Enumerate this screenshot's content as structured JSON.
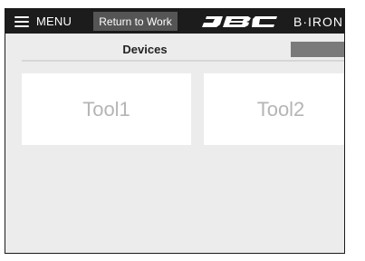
{
  "topbar": {
    "menu_label": "MENU",
    "return_label": "Return to Work",
    "brand_text": "B·IRON",
    "background_color": "#1c1c1c"
  },
  "tabs": {
    "devices_label": "Devices"
  },
  "tools": [
    {
      "label": "Tool1"
    },
    {
      "label": "Tool2"
    }
  ],
  "colors": {
    "screen_background": "#ececec",
    "card_background": "#ffffff",
    "card_text": "#b5b5b5",
    "return_button": "#555555"
  },
  "icons": {
    "menu": "hamburger-icon",
    "logo": "jbc-logo"
  }
}
